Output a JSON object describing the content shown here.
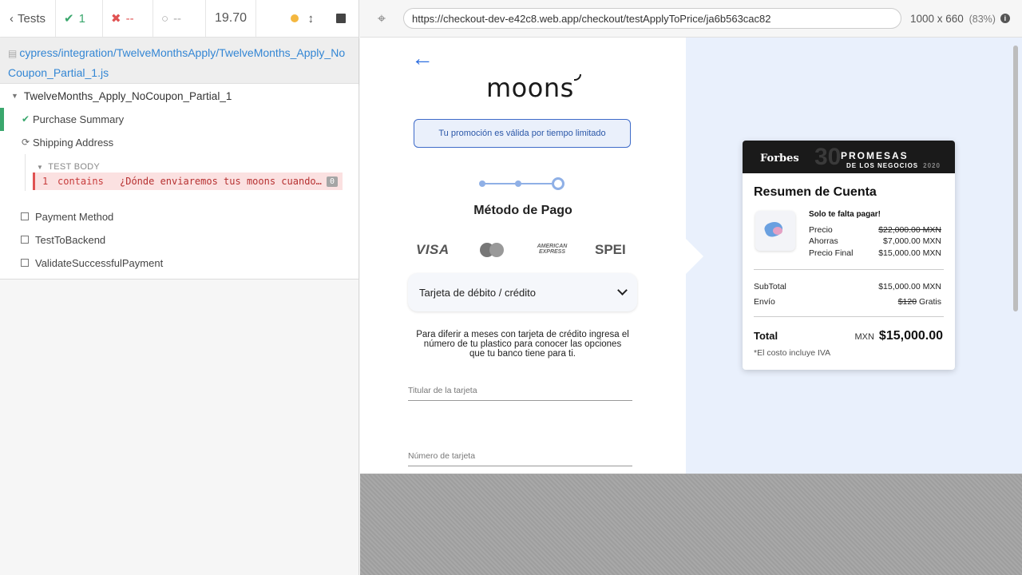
{
  "runner": {
    "tests_label": "Tests",
    "passed": "1",
    "failed": "--",
    "pending": "--",
    "duration": "19.70",
    "spec_path": "cypress/integration/TwelveMonthsApply/TwelveMonths_Apply_NoCoupon_Partial_1.js",
    "suite_title": "TwelveMonths_Apply_NoCoupon_Partial_1",
    "tests": [
      {
        "title": "Purchase Summary",
        "state": "passed"
      },
      {
        "title": "Shipping Address",
        "state": "running"
      },
      {
        "title": "Payment Method",
        "state": "pending"
      },
      {
        "title": "TestToBackend",
        "state": "pending"
      },
      {
        "title": "ValidateSuccessfulPayment",
        "state": "pending"
      }
    ],
    "test_body_label": "TEST BODY",
    "command": {
      "number": "1",
      "name": "contains",
      "message": "¿Dónde enviaremos tus moons cuando estén listos?",
      "badge": "0"
    }
  },
  "aut": {
    "url": "https://checkout-dev-e42c8.web.app/checkout/testApplyToPrice/ja6b563cac82",
    "viewport": "1000 x 660",
    "scale": "(83%)"
  },
  "checkout": {
    "back_arrow": "←",
    "logo": "moons",
    "promo_text": "Tu promoción es válida por tiempo limitado",
    "step_current": 3,
    "step_total": 3,
    "payment_title": "Método de Pago",
    "brands": {
      "visa": "VISA",
      "amex": "AMERICAN EXPRESS",
      "spei": "SPEI"
    },
    "method_selected": "Tarjeta de débito / crédito",
    "instructions": "Para diferir a meses con tarjeta de crédito ingresa el número de tu plastico para conocer las opciones que tu banco tiene para ti.",
    "field_holder": "Titular de la tarjeta",
    "field_number": "Número de tarjeta"
  },
  "summary": {
    "banner_brand": "Forbes",
    "banner_number": "30",
    "banner_line1": "PROMESAS",
    "banner_line2": "DE LOS NEGOCIOS",
    "banner_year": "2020",
    "title": "Resumen de Cuenta",
    "pending_label": "Solo te falta pagar!",
    "price_label": "Precio",
    "price_value": "$22,000.00 MXN",
    "savings_label": "Ahorras",
    "savings_value": "$7,000.00 MXN",
    "final_label": "Precio Final",
    "final_value": "$15,000.00 MXN",
    "subtotal_label": "SubTotal",
    "subtotal_value": "$15,000.00 MXN",
    "shipping_label": "Envío",
    "shipping_old": "$120",
    "shipping_value": "Gratis",
    "total_label": "Total",
    "total_currency": "MXN",
    "total_value": "$15,000.00",
    "iva_note": "*El costo incluye IVA"
  }
}
